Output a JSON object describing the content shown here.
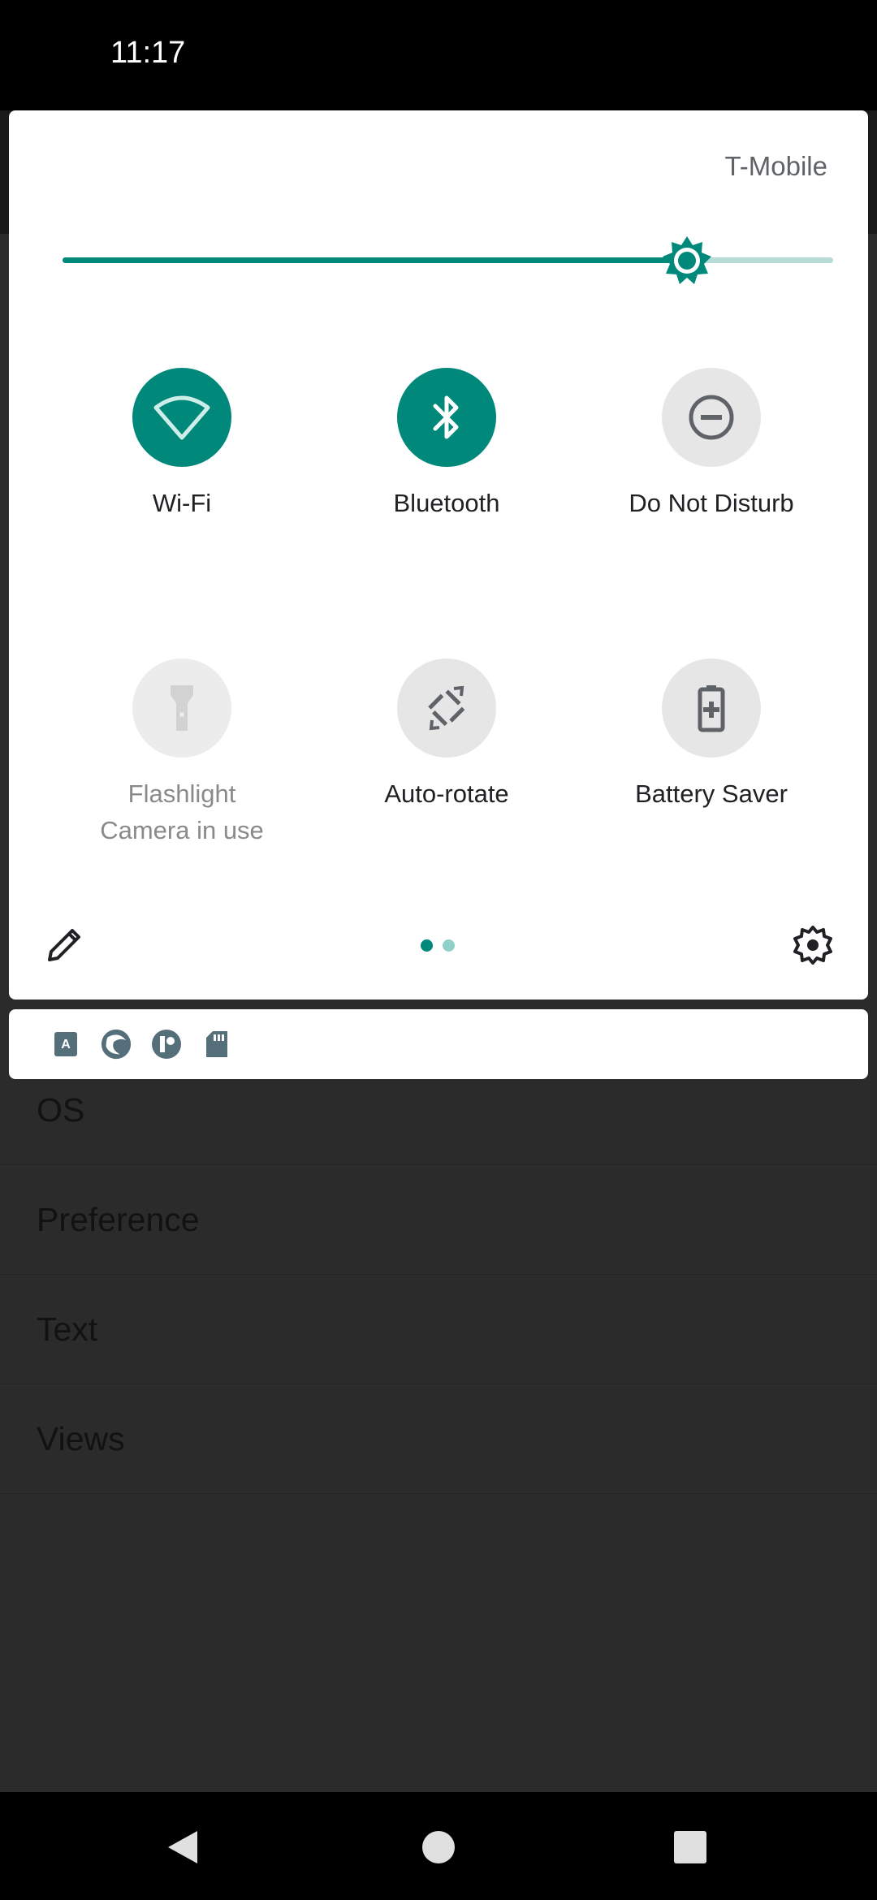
{
  "status_bar": {
    "time": "11:17"
  },
  "quick_settings": {
    "carrier": "T-Mobile",
    "brightness_level": 0.81,
    "colors": {
      "accent": "#00897b",
      "track": "#b7dcd8",
      "tile_off": "#e6e6e6"
    },
    "tiles": [
      {
        "label": "Wi-Fi",
        "sublabel": "",
        "state": "on",
        "icon": "wifi-icon"
      },
      {
        "label": "Bluetooth",
        "sublabel": "",
        "state": "on",
        "icon": "bluetooth-icon"
      },
      {
        "label": "Do Not Disturb",
        "sublabel": "",
        "state": "off",
        "icon": "do-not-disturb-icon"
      },
      {
        "label": "Flashlight",
        "sublabel": "Camera in use",
        "state": "unavailable",
        "icon": "flashlight-icon"
      },
      {
        "label": "Auto-rotate",
        "sublabel": "",
        "state": "off",
        "icon": "auto-rotate-icon"
      },
      {
        "label": "Battery Saver",
        "sublabel": "",
        "state": "off",
        "icon": "battery-saver-icon"
      }
    ],
    "page_indicator": {
      "pages": 2,
      "current": 1
    },
    "footer": {
      "edit_icon": "pencil-icon",
      "settings_icon": "gear-icon"
    }
  },
  "notification_icons": [
    "text-app-icon",
    "browser-icon",
    "app-icon",
    "sd-card-icon"
  ],
  "background_list": {
    "items": [
      "OS",
      "Preference",
      "Text",
      "Views"
    ]
  },
  "nav_bar": {
    "buttons": [
      "back-icon",
      "home-icon",
      "recents-icon"
    ]
  }
}
